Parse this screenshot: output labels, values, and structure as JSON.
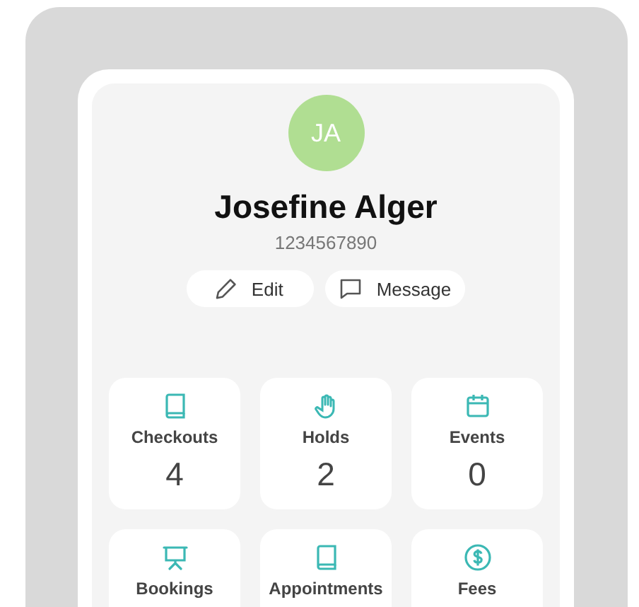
{
  "profile": {
    "initials": "JA",
    "name": "Josefine Alger",
    "number": "1234567890"
  },
  "actions": [
    {
      "kind": "edit",
      "label": "Edit"
    },
    {
      "kind": "message",
      "label": "Message"
    }
  ],
  "tiles": [
    {
      "kind": "book",
      "label": "Checkouts",
      "value": "4"
    },
    {
      "kind": "hand",
      "label": "Holds",
      "value": "2"
    },
    {
      "kind": "calendar",
      "label": "Events",
      "value": "0"
    },
    {
      "kind": "easel",
      "label": "Bookings"
    },
    {
      "kind": "book",
      "label": "Appointments"
    },
    {
      "kind": "dollar",
      "label": "Fees"
    }
  ]
}
